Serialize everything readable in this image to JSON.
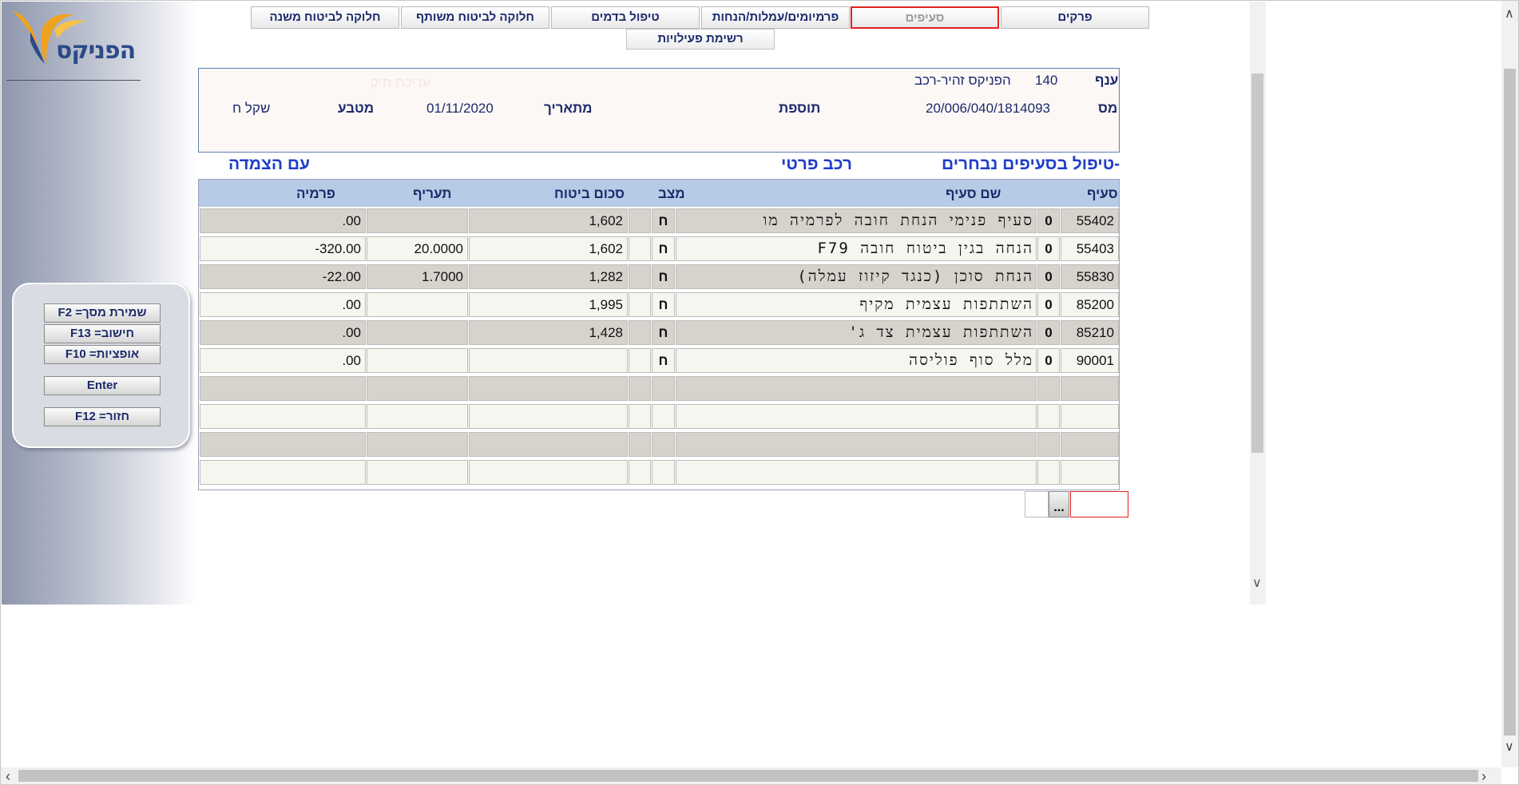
{
  "logo": {
    "text": "הפניקס"
  },
  "tabs": {
    "clauses": "סעיפים",
    "chapters": "פרקים",
    "premiums": "פרמיומים/עמלות/הנחות",
    "claims": "טיפול בדמים",
    "coinsurance": "חלוקה לביטוח משותף",
    "secondary": "חלוקה לביטוח משנה",
    "activities": "רשימת פעילויות"
  },
  "header": {
    "branch_label": "ענף",
    "branch_code": "140",
    "branch_name": "הפניקס זהיר-רכב",
    "policy_label": "מס",
    "policy_number": "20/006/040/1814093",
    "addition_label": "תוספת",
    "from_date_label": "מתאריך",
    "from_date": "01/11/2020",
    "currency_label": "מטבע",
    "currency_value": "שקל ח",
    "faded_text": "עריכת תיק"
  },
  "section": {
    "title": "-טיפול בסעיפים נבחרים",
    "vehicle": "רכב פרטי",
    "indexation": "עם הצמדה"
  },
  "table": {
    "headers": {
      "clause": "סעיף",
      "clause_name": "שם סעיף",
      "status": "מצב",
      "sum_insured": "סכום ביטוח",
      "rate": "תעריף",
      "premium": "פרמיה"
    },
    "rows": [
      {
        "clause": "55402",
        "flag": "0",
        "name": "סעיף פנימי הנחת חובה לפרמיה מו",
        "status": "ח",
        "sum": "1,602",
        "rate": "",
        "premium": ".00"
      },
      {
        "clause": "55403",
        "flag": "0",
        "name": "הנחה בגין ביטוח חובה F79",
        "status": "ח",
        "sum": "1,602",
        "rate": "20.0000",
        "premium": "-320.00"
      },
      {
        "clause": "55830",
        "flag": "0",
        "name": "הנחת סוכן (כנגד קיזוז עמלה)",
        "status": "ח",
        "sum": "1,282",
        "rate": "1.7000",
        "premium": "-22.00"
      },
      {
        "clause": "85200",
        "flag": "0",
        "name": "השתתפות עצמית מקיף",
        "status": "ח",
        "sum": "1,995",
        "rate": "",
        "premium": ".00"
      },
      {
        "clause": "85210",
        "flag": "0",
        "name": "השתתפות עצמית צד ג'",
        "status": "ח",
        "sum": "1,428",
        "rate": "",
        "premium": ".00"
      },
      {
        "clause": "90001",
        "flag": "0",
        "name": "מלל סוף פוליסה",
        "status": "ח",
        "sum": "",
        "rate": "",
        "premium": ".00"
      },
      {
        "clause": "",
        "flag": "",
        "name": "",
        "status": "",
        "sum": "",
        "rate": "",
        "premium": ""
      },
      {
        "clause": "",
        "flag": "",
        "name": "",
        "status": "",
        "sum": "",
        "rate": "",
        "premium": ""
      },
      {
        "clause": "",
        "flag": "",
        "name": "",
        "status": "",
        "sum": "",
        "rate": "",
        "premium": ""
      },
      {
        "clause": "",
        "flag": "",
        "name": "",
        "status": "",
        "sum": "",
        "rate": "",
        "premium": ""
      }
    ],
    "row_colors": {
      "odd": "#d6d3cc",
      "even": "#f6f5ef"
    }
  },
  "fkeys": {
    "save": "שמירת מסך= F2",
    "calc": "חישוב= F13",
    "options": "אופציות= F10",
    "enter": "Enter",
    "back": "חזור= F12"
  },
  "lookup": {
    "label": "..."
  },
  "icons": {
    "inner_scroll_down": "chevron-down-icon",
    "outer_scroll_up": "chevron-up-icon",
    "outer_scroll_down": "chevron-down-icon",
    "outer_scroll_left": "chevron-left-icon",
    "outer_scroll_right": "chevron-right-icon"
  }
}
